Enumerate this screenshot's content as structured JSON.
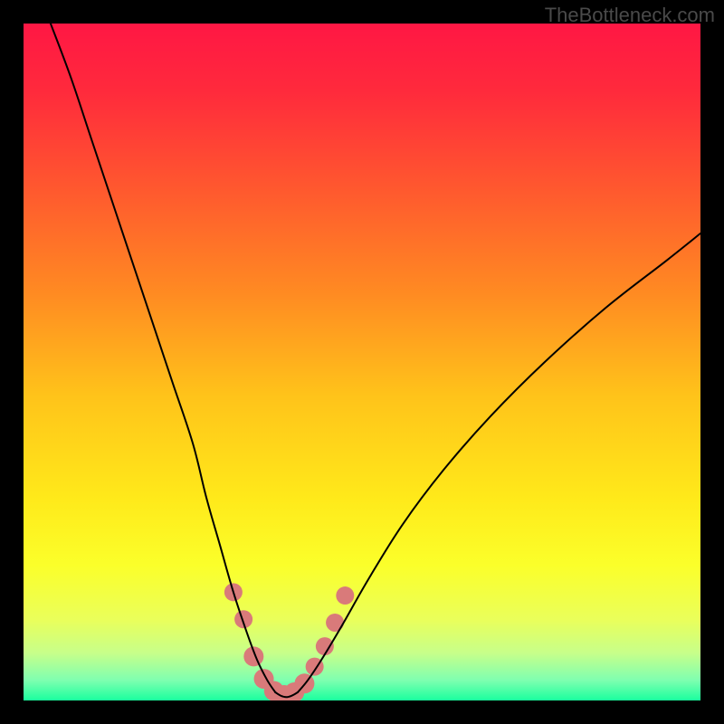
{
  "watermark": "TheBottleneck.com",
  "chart_data": {
    "type": "line",
    "title": "",
    "xlabel": "",
    "ylabel": "",
    "xlim": [
      0,
      100
    ],
    "ylim": [
      0,
      100
    ],
    "grid": false,
    "background_gradient": {
      "stops": [
        {
          "offset": 0.0,
          "color": "#ff1744"
        },
        {
          "offset": 0.1,
          "color": "#ff2a3c"
        },
        {
          "offset": 0.25,
          "color": "#ff5a2e"
        },
        {
          "offset": 0.4,
          "color": "#ff8b22"
        },
        {
          "offset": 0.55,
          "color": "#ffc31a"
        },
        {
          "offset": 0.7,
          "color": "#ffe91a"
        },
        {
          "offset": 0.8,
          "color": "#fbff2a"
        },
        {
          "offset": 0.88,
          "color": "#eaff5a"
        },
        {
          "offset": 0.93,
          "color": "#c7ff8a"
        },
        {
          "offset": 0.97,
          "color": "#7fffb0"
        },
        {
          "offset": 1.0,
          "color": "#1aff9e"
        }
      ]
    },
    "series": [
      {
        "name": "curve-left",
        "stroke": "#000000",
        "x": [
          4,
          7,
          10,
          13,
          16,
          19,
          22,
          25,
          27,
          29,
          31,
          33,
          34.5,
          36,
          37.2
        ],
        "y": [
          100,
          92,
          83,
          74,
          65,
          56,
          47,
          38,
          30,
          23,
          16,
          10,
          6,
          3,
          1.2
        ]
      },
      {
        "name": "curve-right",
        "stroke": "#000000",
        "x": [
          40.5,
          42,
          44,
          47,
          51,
          56,
          62,
          69,
          77,
          86,
          95,
          100
        ],
        "y": [
          1.2,
          3,
          6,
          11,
          18,
          26,
          34,
          42,
          50,
          58,
          65,
          69
        ]
      },
      {
        "name": "valley-floor",
        "stroke": "#000000",
        "x": [
          37.2,
          38.0,
          38.8,
          39.6,
          40.5
        ],
        "y": [
          1.2,
          0.7,
          0.5,
          0.7,
          1.2
        ]
      }
    ],
    "markers": {
      "name": "valley-markers",
      "color": "#d97a7a",
      "points": [
        {
          "x": 31.0,
          "y": 16.0,
          "r": 10
        },
        {
          "x": 32.5,
          "y": 12.0,
          "r": 10
        },
        {
          "x": 34.0,
          "y": 6.5,
          "r": 11
        },
        {
          "x": 35.5,
          "y": 3.2,
          "r": 11
        },
        {
          "x": 37.0,
          "y": 1.4,
          "r": 11
        },
        {
          "x": 38.5,
          "y": 0.8,
          "r": 11
        },
        {
          "x": 40.0,
          "y": 1.2,
          "r": 11
        },
        {
          "x": 41.5,
          "y": 2.5,
          "r": 11
        },
        {
          "x": 43.0,
          "y": 5.0,
          "r": 10
        },
        {
          "x": 44.5,
          "y": 8.0,
          "r": 10
        },
        {
          "x": 46.0,
          "y": 11.5,
          "r": 10
        },
        {
          "x": 47.5,
          "y": 15.5,
          "r": 10
        }
      ]
    }
  }
}
